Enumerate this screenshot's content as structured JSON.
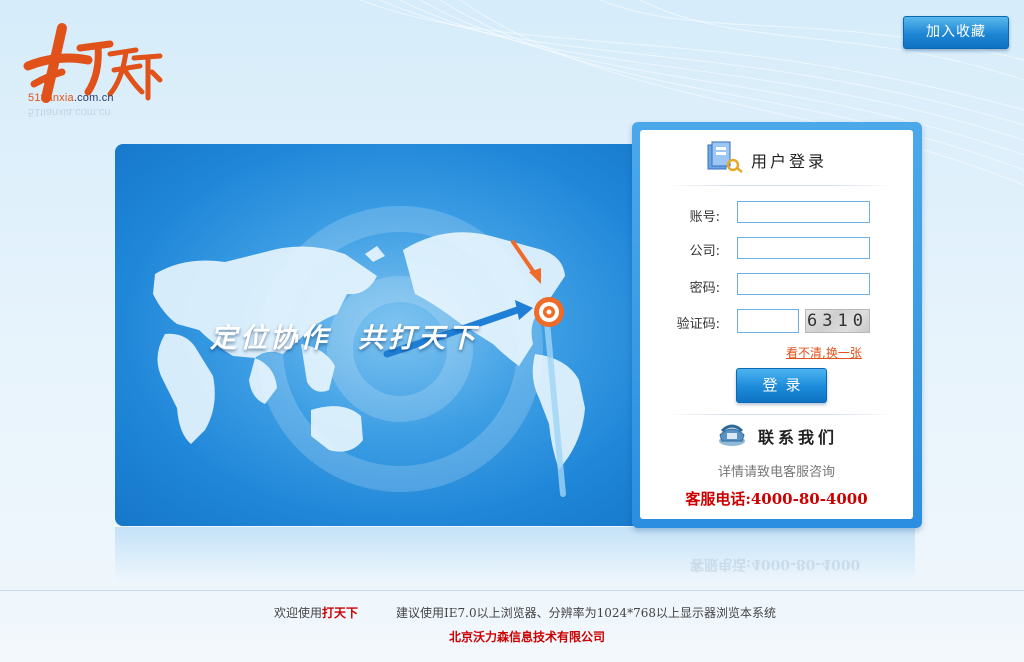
{
  "header": {
    "logo_text_prefix": "51tianxia",
    "logo_text_suffix": ".com.cn",
    "logo_chars": "打天下",
    "bookmark_label": "加入收藏"
  },
  "banner": {
    "slogan_left": "定位协作",
    "slogan_right": "共打天下"
  },
  "login": {
    "title": "用户登录",
    "account_label": "账号:",
    "account_value": "",
    "company_label": "公司:",
    "company_value": "",
    "password_label": "密码:",
    "password_value": "",
    "captcha_label": "验证码:",
    "captcha_value": "",
    "captcha_code": "6310",
    "refresh_link": "看不清,换一张",
    "submit_label": "登录"
  },
  "contact": {
    "title": "联系我们",
    "subtitle": "详情请致电客服咨询",
    "hotline": "客服电话:4000-80-4000",
    "hotline_reflection": "客服电话:4000-80-4000"
  },
  "footer": {
    "welcome_prefix": "欢迎使用",
    "welcome_brand": "打天下",
    "advice": "建议使用IE7.0以上浏览器、分辨率为1024*768以上显示器浏览本系统",
    "company": "北京沃力森信息技术有限公司"
  },
  "colors": {
    "accent_blue": "#1c8ad9",
    "brand_orange": "#e0521a",
    "hotline_red": "#cc0000"
  }
}
